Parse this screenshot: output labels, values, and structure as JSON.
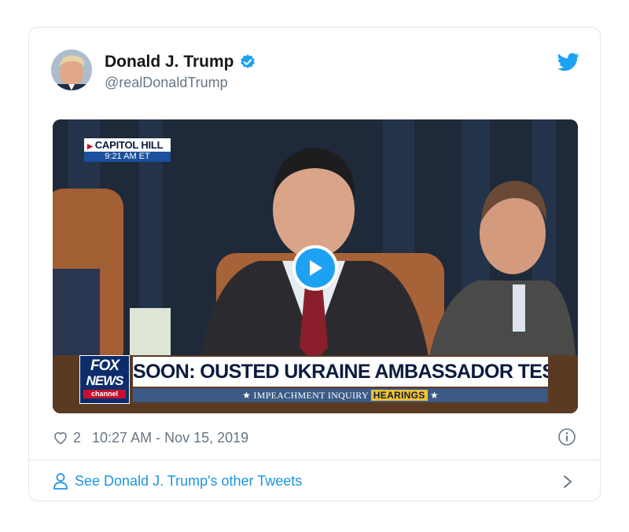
{
  "tweet": {
    "author_name": "Donald J. Trump",
    "author_handle": "@realDonaldTrump",
    "likes": "2",
    "timestamp": "10:27 AM - Nov 15, 2019",
    "footer_link": "See Donald J. Trump's other Tweets"
  },
  "video": {
    "location_label": "CAPITOL HILL",
    "time_label": "9:21 AM ET",
    "network_line1": "FOX",
    "network_line2": "NEWS",
    "network_line3": "channel",
    "headline": "SOON: OUSTED UKRAINE AMBASSADOR TESTIFIES",
    "subline_left": "★ IMPEACHMENT INQUIRY",
    "subline_highlight": "HEARINGS",
    "subline_right": "★"
  },
  "colors": {
    "twitter_blue": "#1da1f2",
    "link_blue": "#1b95e0",
    "text_gray": "#657786",
    "border": "#e1e8ed"
  },
  "icons": {
    "verified": "verified-badge-icon",
    "brand": "twitter-bird-icon",
    "play": "play-icon",
    "like": "heart-icon",
    "info": "info-icon",
    "profile": "person-icon",
    "chevron": "chevron-right-icon"
  }
}
